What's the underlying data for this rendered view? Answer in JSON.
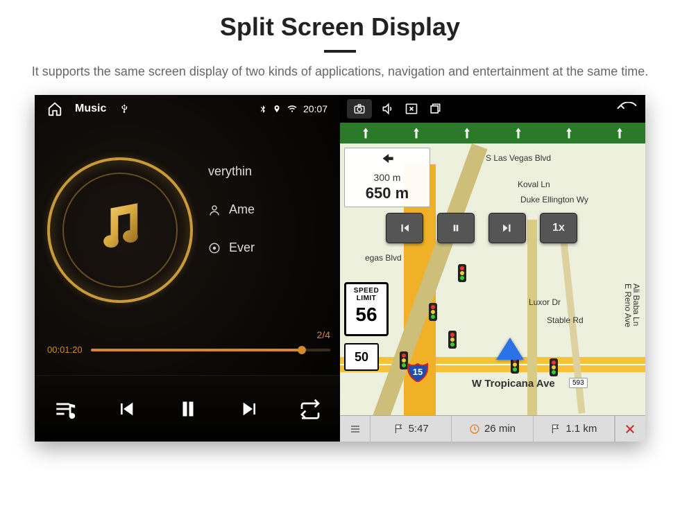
{
  "page": {
    "title": "Split Screen Display",
    "subtitle": "It supports the same screen display of two kinds of applications, navigation and entertainment at the same time."
  },
  "topbar": {
    "music_label": "Music",
    "clock": "20:07"
  },
  "music": {
    "track1": "verythin",
    "track2": "Ame",
    "track3": "Ever",
    "counter": "2/4",
    "elapsed": "00:01:20"
  },
  "nav": {
    "lane_count": 6,
    "turn_dist_minor": "300 m",
    "turn_dist_major": "650 m",
    "speed_button": "1x",
    "speed_limit_top": "SPEED",
    "speed_limit_mid": "LIMIT",
    "speed_limit_val": "56",
    "route_shield": "50",
    "interstate": "15",
    "streets": {
      "s1": "S Las Vegas Blvd",
      "s2": "Koval Ln",
      "s3": "Duke Ellington Wy",
      "s4": "egas Blvd",
      "s5": "Luxor Dr",
      "s6": "Stable Rd",
      "s7": "Ali Baba Ln",
      "s8": "E Reno Ave",
      "s9": "W Tropicana Ave",
      "badge": "593"
    },
    "bottom": {
      "eta": "5:47",
      "remaining_time": "26 min",
      "remaining_dist": "1.1 km"
    }
  }
}
